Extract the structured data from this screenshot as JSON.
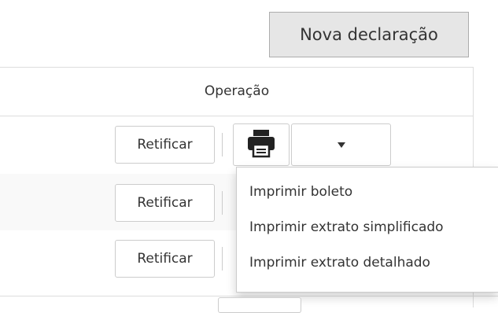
{
  "toolbar": {
    "new_declaration_label": "Nova declaração"
  },
  "table": {
    "header": {
      "operation": "Operação"
    },
    "rows": [
      {
        "action_label": "Retificar"
      },
      {
        "action_label": "Retificar"
      },
      {
        "action_label": "Retificar"
      }
    ]
  },
  "print_group": {
    "icon": "printer-icon",
    "toggle_icon": "caret-down-icon"
  },
  "print_menu": {
    "items": [
      {
        "label": "Imprimir boleto"
      },
      {
        "label": "Imprimir extrato simplificado"
      },
      {
        "label": "Imprimir extrato detalhado"
      }
    ]
  },
  "colors": {
    "button_primary_bg": "#e6e6e6",
    "border": "#cccccc",
    "grid_line": "#dddddd",
    "text": "#333333",
    "striped_row": "#f9f9f9"
  }
}
